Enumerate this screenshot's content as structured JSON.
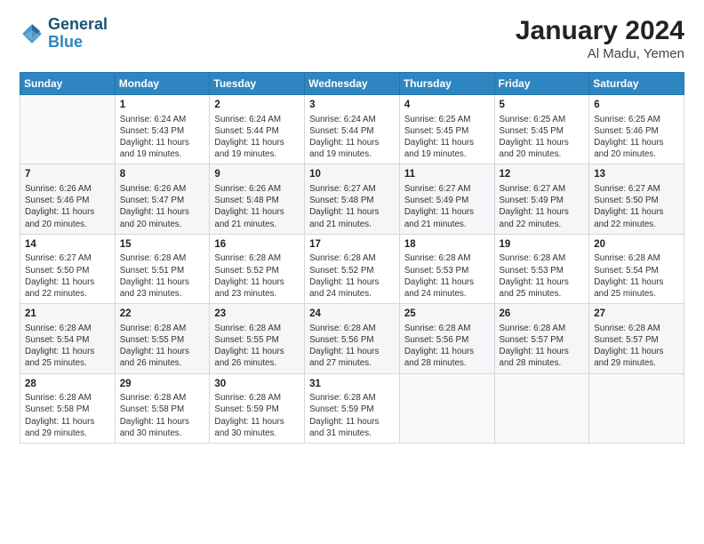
{
  "logo": {
    "line1": "General",
    "line2": "Blue"
  },
  "title": "January 2024",
  "location": "Al Madu, Yemen",
  "days_header": [
    "Sunday",
    "Monday",
    "Tuesday",
    "Wednesday",
    "Thursday",
    "Friday",
    "Saturday"
  ],
  "weeks": [
    [
      {
        "day": "",
        "info": ""
      },
      {
        "day": "1",
        "info": "Sunrise: 6:24 AM\nSunset: 5:43 PM\nDaylight: 11 hours\nand 19 minutes."
      },
      {
        "day": "2",
        "info": "Sunrise: 6:24 AM\nSunset: 5:44 PM\nDaylight: 11 hours\nand 19 minutes."
      },
      {
        "day": "3",
        "info": "Sunrise: 6:24 AM\nSunset: 5:44 PM\nDaylight: 11 hours\nand 19 minutes."
      },
      {
        "day": "4",
        "info": "Sunrise: 6:25 AM\nSunset: 5:45 PM\nDaylight: 11 hours\nand 19 minutes."
      },
      {
        "day": "5",
        "info": "Sunrise: 6:25 AM\nSunset: 5:45 PM\nDaylight: 11 hours\nand 20 minutes."
      },
      {
        "day": "6",
        "info": "Sunrise: 6:25 AM\nSunset: 5:46 PM\nDaylight: 11 hours\nand 20 minutes."
      }
    ],
    [
      {
        "day": "7",
        "info": "Sunrise: 6:26 AM\nSunset: 5:46 PM\nDaylight: 11 hours\nand 20 minutes."
      },
      {
        "day": "8",
        "info": "Sunrise: 6:26 AM\nSunset: 5:47 PM\nDaylight: 11 hours\nand 20 minutes."
      },
      {
        "day": "9",
        "info": "Sunrise: 6:26 AM\nSunset: 5:48 PM\nDaylight: 11 hours\nand 21 minutes."
      },
      {
        "day": "10",
        "info": "Sunrise: 6:27 AM\nSunset: 5:48 PM\nDaylight: 11 hours\nand 21 minutes."
      },
      {
        "day": "11",
        "info": "Sunrise: 6:27 AM\nSunset: 5:49 PM\nDaylight: 11 hours\nand 21 minutes."
      },
      {
        "day": "12",
        "info": "Sunrise: 6:27 AM\nSunset: 5:49 PM\nDaylight: 11 hours\nand 22 minutes."
      },
      {
        "day": "13",
        "info": "Sunrise: 6:27 AM\nSunset: 5:50 PM\nDaylight: 11 hours\nand 22 minutes."
      }
    ],
    [
      {
        "day": "14",
        "info": "Sunrise: 6:27 AM\nSunset: 5:50 PM\nDaylight: 11 hours\nand 22 minutes."
      },
      {
        "day": "15",
        "info": "Sunrise: 6:28 AM\nSunset: 5:51 PM\nDaylight: 11 hours\nand 23 minutes."
      },
      {
        "day": "16",
        "info": "Sunrise: 6:28 AM\nSunset: 5:52 PM\nDaylight: 11 hours\nand 23 minutes."
      },
      {
        "day": "17",
        "info": "Sunrise: 6:28 AM\nSunset: 5:52 PM\nDaylight: 11 hours\nand 24 minutes."
      },
      {
        "day": "18",
        "info": "Sunrise: 6:28 AM\nSunset: 5:53 PM\nDaylight: 11 hours\nand 24 minutes."
      },
      {
        "day": "19",
        "info": "Sunrise: 6:28 AM\nSunset: 5:53 PM\nDaylight: 11 hours\nand 25 minutes."
      },
      {
        "day": "20",
        "info": "Sunrise: 6:28 AM\nSunset: 5:54 PM\nDaylight: 11 hours\nand 25 minutes."
      }
    ],
    [
      {
        "day": "21",
        "info": "Sunrise: 6:28 AM\nSunset: 5:54 PM\nDaylight: 11 hours\nand 25 minutes."
      },
      {
        "day": "22",
        "info": "Sunrise: 6:28 AM\nSunset: 5:55 PM\nDaylight: 11 hours\nand 26 minutes."
      },
      {
        "day": "23",
        "info": "Sunrise: 6:28 AM\nSunset: 5:55 PM\nDaylight: 11 hours\nand 26 minutes."
      },
      {
        "day": "24",
        "info": "Sunrise: 6:28 AM\nSunset: 5:56 PM\nDaylight: 11 hours\nand 27 minutes."
      },
      {
        "day": "25",
        "info": "Sunrise: 6:28 AM\nSunset: 5:56 PM\nDaylight: 11 hours\nand 28 minutes."
      },
      {
        "day": "26",
        "info": "Sunrise: 6:28 AM\nSunset: 5:57 PM\nDaylight: 11 hours\nand 28 minutes."
      },
      {
        "day": "27",
        "info": "Sunrise: 6:28 AM\nSunset: 5:57 PM\nDaylight: 11 hours\nand 29 minutes."
      }
    ],
    [
      {
        "day": "28",
        "info": "Sunrise: 6:28 AM\nSunset: 5:58 PM\nDaylight: 11 hours\nand 29 minutes."
      },
      {
        "day": "29",
        "info": "Sunrise: 6:28 AM\nSunset: 5:58 PM\nDaylight: 11 hours\nand 30 minutes."
      },
      {
        "day": "30",
        "info": "Sunrise: 6:28 AM\nSunset: 5:59 PM\nDaylight: 11 hours\nand 30 minutes."
      },
      {
        "day": "31",
        "info": "Sunrise: 6:28 AM\nSunset: 5:59 PM\nDaylight: 11 hours\nand 31 minutes."
      },
      {
        "day": "",
        "info": ""
      },
      {
        "day": "",
        "info": ""
      },
      {
        "day": "",
        "info": ""
      }
    ]
  ]
}
